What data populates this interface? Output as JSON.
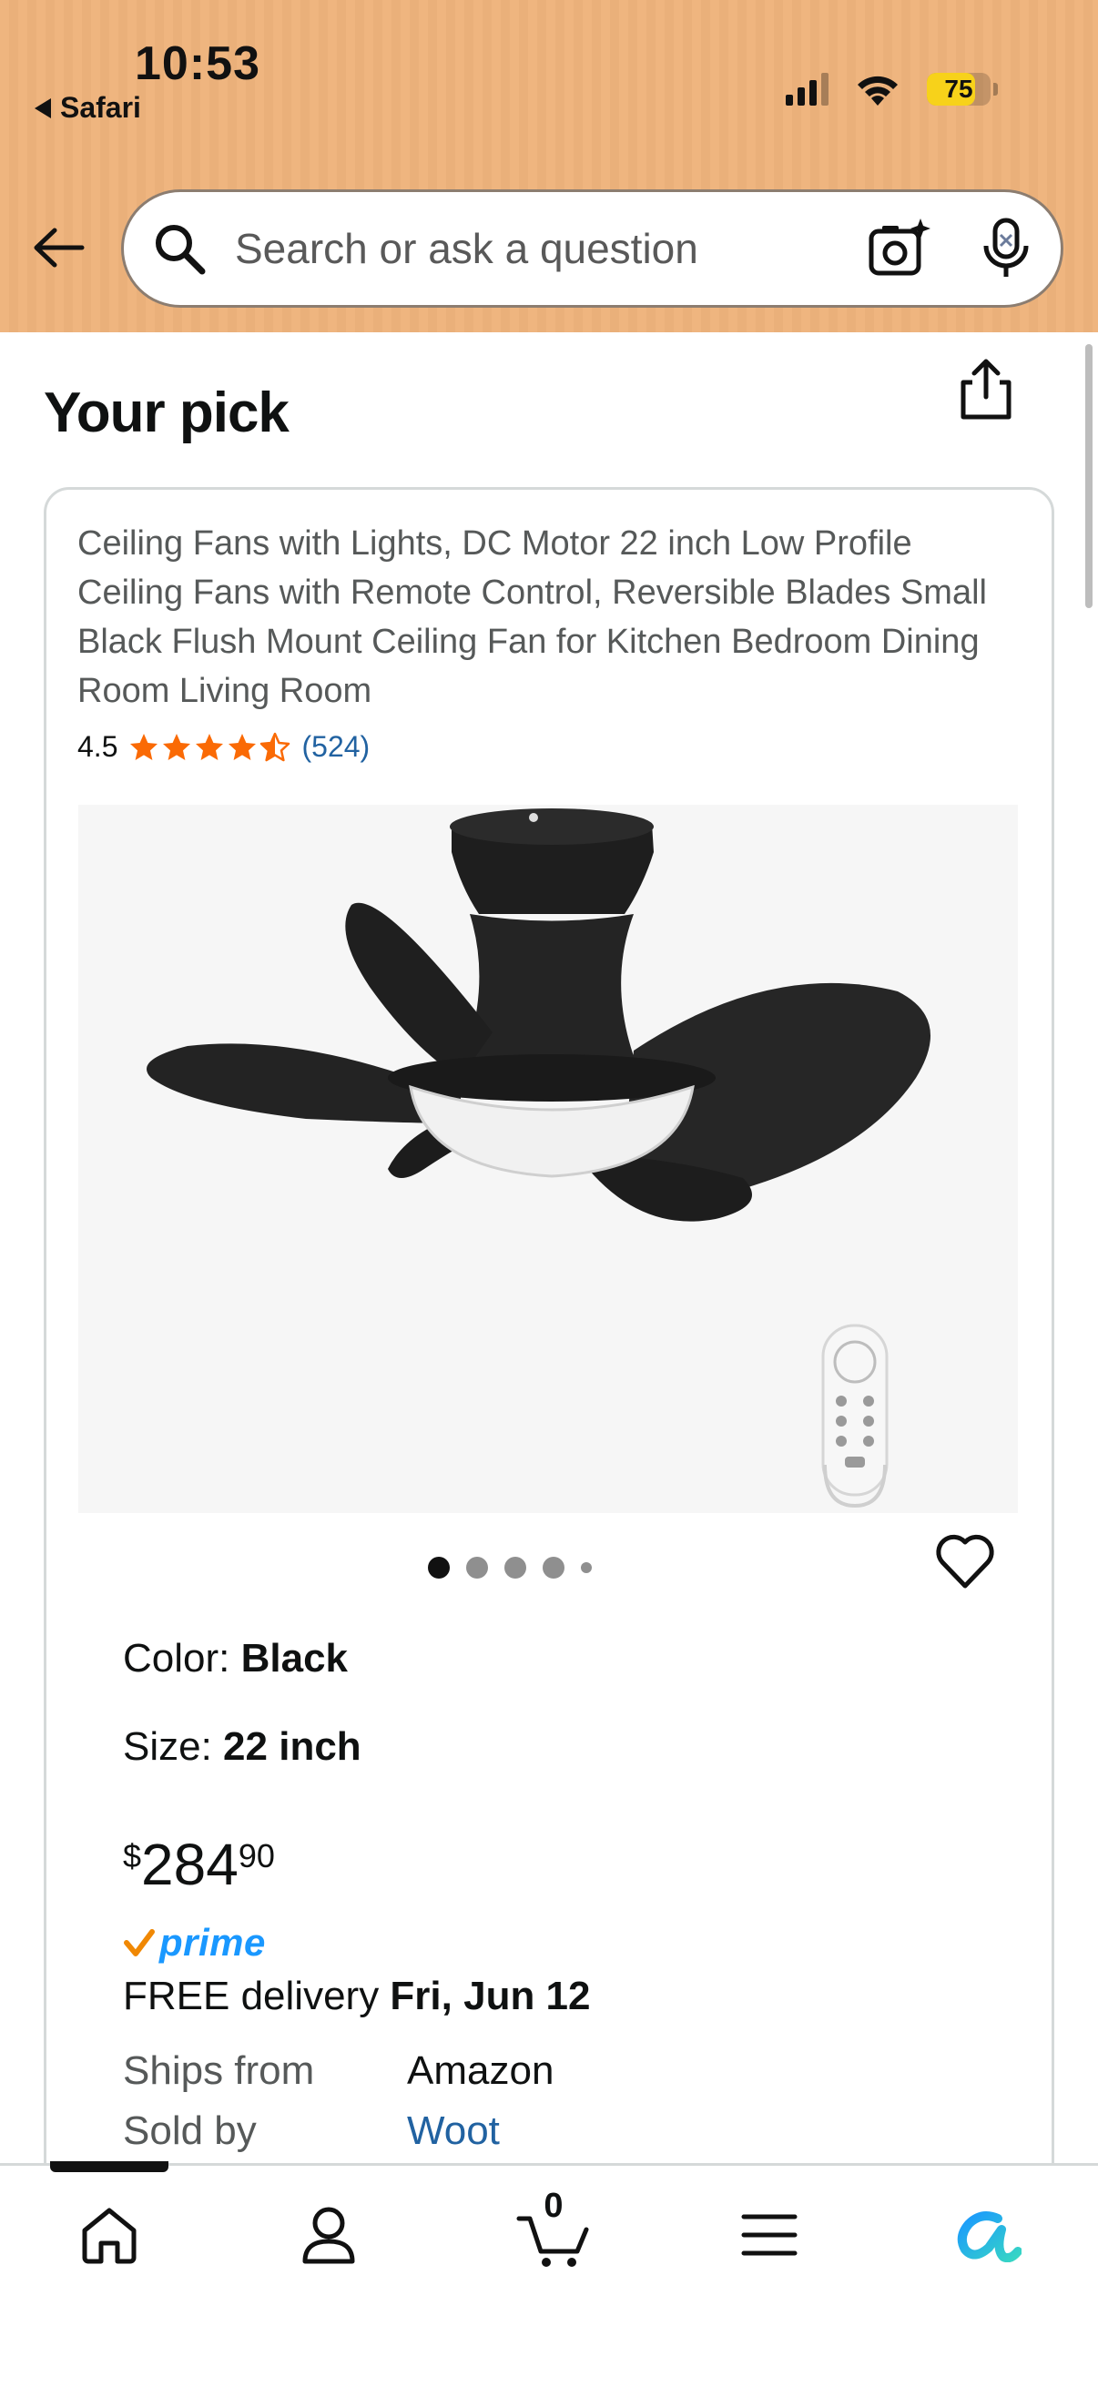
{
  "status_bar": {
    "time": "10:53",
    "back_app": "Safari",
    "battery": "75",
    "battery_level": 0.75
  },
  "search": {
    "placeholder": "Search or ask a question"
  },
  "section": {
    "title": "Your pick"
  },
  "product": {
    "title": "Ceiling Fans with Lights, DC Motor 22 inch Low Profile Ceiling Fans with Remote Control, Reversible Blades Small Black Flush Mount Ceiling Fan for Kitchen Bedroom Dining Room Living Room",
    "rating": "4.5",
    "rating_value": 4.5,
    "review_count": "(524)",
    "image_count": 5,
    "active_image": 1,
    "color_label": "Color: ",
    "color_value": "Black",
    "size_label": "Size: ",
    "size_value": "22 inch",
    "price_symbol": "$",
    "price_whole": "284",
    "price_fraction": "90",
    "prime": "prime",
    "delivery_prefix": "FREE delivery ",
    "delivery_date": "Fri, Jun 12",
    "ships_from_label": "Ships from",
    "ships_from_value": "Amazon",
    "sold_by_label": "Sold by",
    "sold_by_value": "Woot"
  },
  "nav": {
    "cart_count": "0",
    "items": [
      "home-icon",
      "account-icon",
      "cart-icon",
      "menu-icon",
      "rufus-icon"
    ]
  },
  "colors": {
    "header_bg": "#efb57f",
    "star": "#fa6a05",
    "link": "#2162a1",
    "prime_blue": "#1a98ff",
    "prime_check": "#f08804",
    "battery": "#f7d21a"
  }
}
